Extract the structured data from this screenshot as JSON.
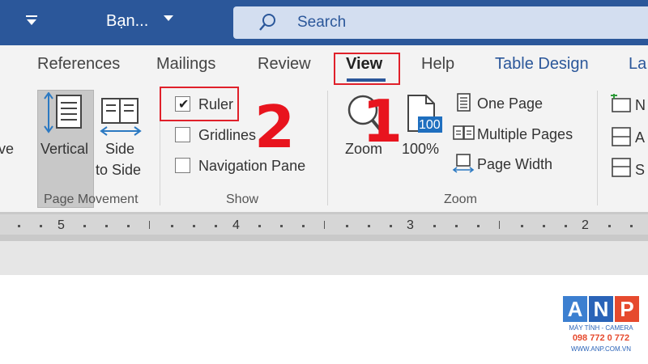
{
  "titlebar": {
    "doc_title": "Bạn...",
    "search_label": "Search",
    "color": "#2b579a"
  },
  "tabs": [
    {
      "label": "References"
    },
    {
      "label": "Mailings"
    },
    {
      "label": "Review"
    },
    {
      "label": "View",
      "active": true
    },
    {
      "label": "Help"
    },
    {
      "label": "Table Design"
    },
    {
      "label": "La"
    }
  ],
  "groups": {
    "page_movement": {
      "label": "Page Movement",
      "partial_prev": "ve",
      "vertical_line1": "Vertical",
      "side_line1": "Side",
      "side_line2": "to Side"
    },
    "show": {
      "label": "Show",
      "ruler": {
        "label": "Ruler",
        "checked": true
      },
      "gridlines": {
        "label": "Gridlines",
        "checked": false
      },
      "navigation_pane": {
        "label": "Navigation Pane",
        "checked": false
      }
    },
    "zoom": {
      "label": "Zoom",
      "zoom_btn": "Zoom",
      "hundred_btn": "100%",
      "hundred_badge": "100",
      "one_page": "One Page",
      "multiple_pages": "Multiple Pages",
      "page_width": "Page Width"
    },
    "next_partial": [
      "N",
      "A",
      "S"
    ]
  },
  "ruler": {
    "numbers": [
      "5",
      "4",
      "3",
      "2"
    ]
  },
  "annotations": {
    "step1": "1",
    "step2": "2",
    "color": "#e0202a"
  },
  "logo": {
    "letters": [
      "A",
      "N",
      "P"
    ],
    "tagline": "MÁY TÍNH - CAMERA",
    "phone": "098 772 0 772",
    "website": "WWW.ANP.COM.VN"
  }
}
